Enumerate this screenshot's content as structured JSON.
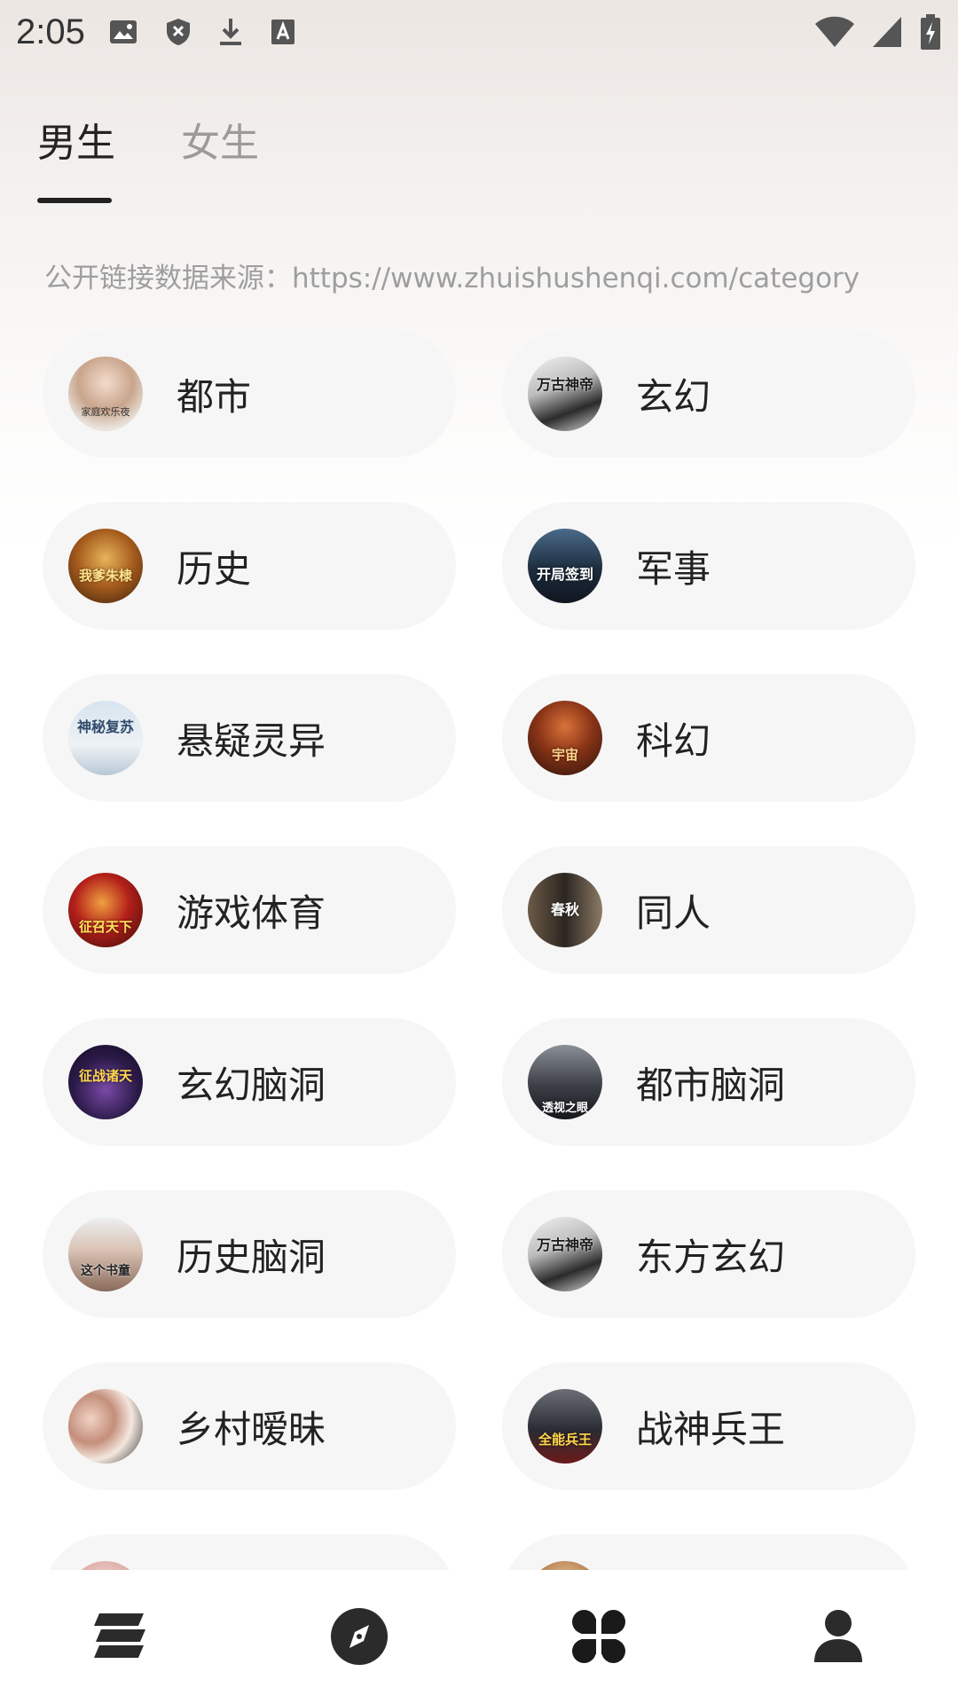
{
  "status_bar": {
    "time": "2:05",
    "left_icons": [
      "image-icon",
      "shield-x-icon",
      "download-icon",
      "font-a-icon"
    ],
    "right_icons": [
      "wifi-icon",
      "signal-icon",
      "battery-charging-icon"
    ]
  },
  "tabs": [
    {
      "label": "男生",
      "active": true
    },
    {
      "label": "女生",
      "active": false
    }
  ],
  "source_text": "公开链接数据来源：https://www.zhuishushenqi.com/category",
  "categories": [
    {
      "label": "都市",
      "cover_text": "家庭欢乐夜"
    },
    {
      "label": "玄幻",
      "cover_text": "万古神帝"
    },
    {
      "label": "历史",
      "cover_text": "我爹朱棣"
    },
    {
      "label": "军事",
      "cover_text": "开局签到"
    },
    {
      "label": "悬疑灵异",
      "cover_text": "神秘复苏"
    },
    {
      "label": "科幻",
      "cover_text": "宇宙"
    },
    {
      "label": "游戏体育",
      "cover_text": "征召天下"
    },
    {
      "label": "同人",
      "cover_text": "春秋"
    },
    {
      "label": "玄幻脑洞",
      "cover_text": "征战诸天"
    },
    {
      "label": "都市脑洞",
      "cover_text": "透视之眼"
    },
    {
      "label": "历史脑洞",
      "cover_text": "这个书童"
    },
    {
      "label": "东方玄幻",
      "cover_text": "万古神帝"
    },
    {
      "label": "乡村暧昧",
      "cover_text": ""
    },
    {
      "label": "战神兵王",
      "cover_text": "全能兵王"
    },
    {
      "label": "",
      "cover_text": ""
    },
    {
      "label": "",
      "cover_text": ""
    }
  ],
  "bottom_nav": [
    {
      "icon": "bookshelf-icon"
    },
    {
      "icon": "compass-icon"
    },
    {
      "icon": "category-grid-icon"
    },
    {
      "icon": "user-icon"
    }
  ],
  "colors": {
    "accent": "#222222",
    "inactive_tab": "#9a9a9a",
    "card_bg": "#f6f6f6"
  }
}
